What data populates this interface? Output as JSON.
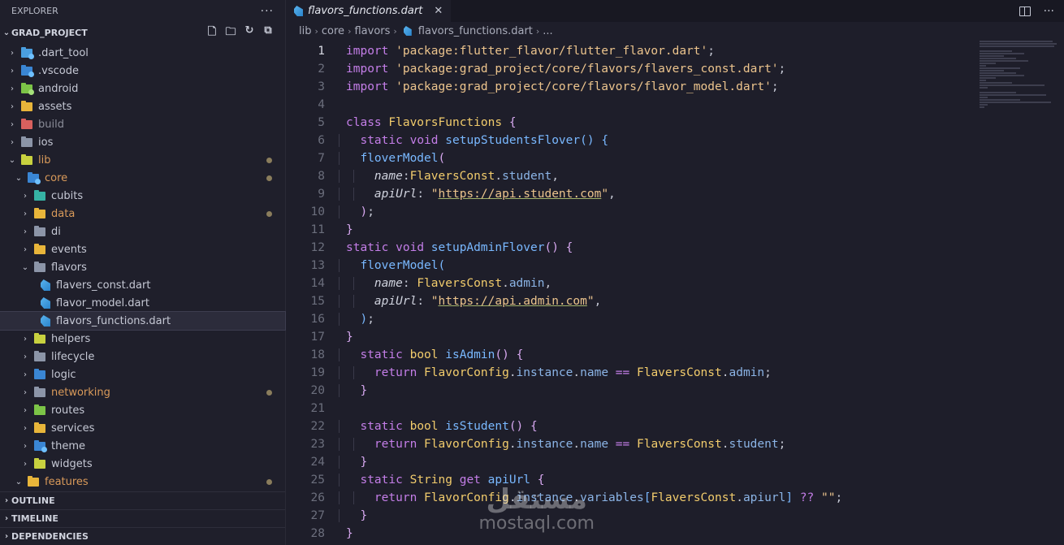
{
  "explorer": {
    "header": "EXPLORER",
    "more": "···",
    "project": "GRAD_PROJECT",
    "tree": [
      {
        "label": ".dart_tool",
        "depth": 0,
        "open": false,
        "color": "#4a9fe0",
        "badge": "#6fc0ff"
      },
      {
        "label": ".vscode",
        "depth": 0,
        "open": false,
        "color": "#3a86d4",
        "badge": "#6fc0ff"
      },
      {
        "label": "android",
        "depth": 0,
        "open": false,
        "color": "#7cc447",
        "badge": "#a4e07a"
      },
      {
        "label": "assets",
        "depth": 0,
        "open": false,
        "color": "#e8b53a",
        "badge": ""
      },
      {
        "label": "build",
        "depth": 0,
        "open": false,
        "color": "#d9605e",
        "badge": "",
        "dim": true
      },
      {
        "label": "ios",
        "depth": 0,
        "open": false,
        "color": "#8c95a8",
        "badge": ""
      },
      {
        "label": "lib",
        "depth": 0,
        "open": true,
        "color": "#c8d13f",
        "badge": "",
        "mod": true
      },
      {
        "label": "core",
        "depth": 1,
        "open": true,
        "color": "#3a86d4",
        "badge": "#6fc0ff",
        "mod": true
      },
      {
        "label": "cubits",
        "depth": 2,
        "open": false,
        "color": "#36b3a4",
        "badge": ""
      },
      {
        "label": "data",
        "depth": 2,
        "open": false,
        "color": "#e8b53a",
        "badge": "",
        "mod": true
      },
      {
        "label": "di",
        "depth": 2,
        "open": false,
        "color": "#8c95a8",
        "badge": ""
      },
      {
        "label": "events",
        "depth": 2,
        "open": false,
        "color": "#e8b53a",
        "badge": ""
      },
      {
        "label": "flavors",
        "depth": 2,
        "open": true,
        "color": "#8c95a8",
        "badge": ""
      },
      {
        "label": "flavers_const.dart",
        "depth": 3,
        "file": true
      },
      {
        "label": "flavor_model.dart",
        "depth": 3,
        "file": true
      },
      {
        "label": "flavors_functions.dart",
        "depth": 3,
        "file": true,
        "selected": true
      },
      {
        "label": "helpers",
        "depth": 2,
        "open": false,
        "color": "#c8d13f",
        "badge": ""
      },
      {
        "label": "lifecycle",
        "depth": 2,
        "open": false,
        "color": "#8c95a8",
        "badge": ""
      },
      {
        "label": "logic",
        "depth": 2,
        "open": false,
        "color": "#3a86d4",
        "badge": ""
      },
      {
        "label": "networking",
        "depth": 2,
        "open": false,
        "color": "#8c95a8",
        "badge": "",
        "mod": true
      },
      {
        "label": "routes",
        "depth": 2,
        "open": false,
        "color": "#7cc447",
        "badge": ""
      },
      {
        "label": "services",
        "depth": 2,
        "open": false,
        "color": "#e8b53a",
        "badge": ""
      },
      {
        "label": "theme",
        "depth": 2,
        "open": false,
        "color": "#3a86d4",
        "badge": "#6fc0ff"
      },
      {
        "label": "widgets",
        "depth": 2,
        "open": false,
        "color": "#c8d13f",
        "badge": ""
      },
      {
        "label": "features",
        "depth": 1,
        "open": true,
        "color": "#e8b53a",
        "badge": "",
        "mod": true
      }
    ],
    "sections": [
      "OUTLINE",
      "TIMELINE",
      "DEPENDENCIES"
    ]
  },
  "editor": {
    "tab_label": "flavors_functions.dart",
    "tab_close": "✕",
    "breadcrumb": [
      "lib",
      "core",
      "flavors",
      "flavors_functions.dart",
      "..."
    ],
    "active_line": 1
  },
  "watermark": {
    "arabic": "مستقل",
    "latin": "mostaql.com"
  },
  "colors": {
    "keyword": "#c47ee8",
    "string": "#ecc48d",
    "class": "#f2cc6c",
    "function": "#79b8ff"
  }
}
